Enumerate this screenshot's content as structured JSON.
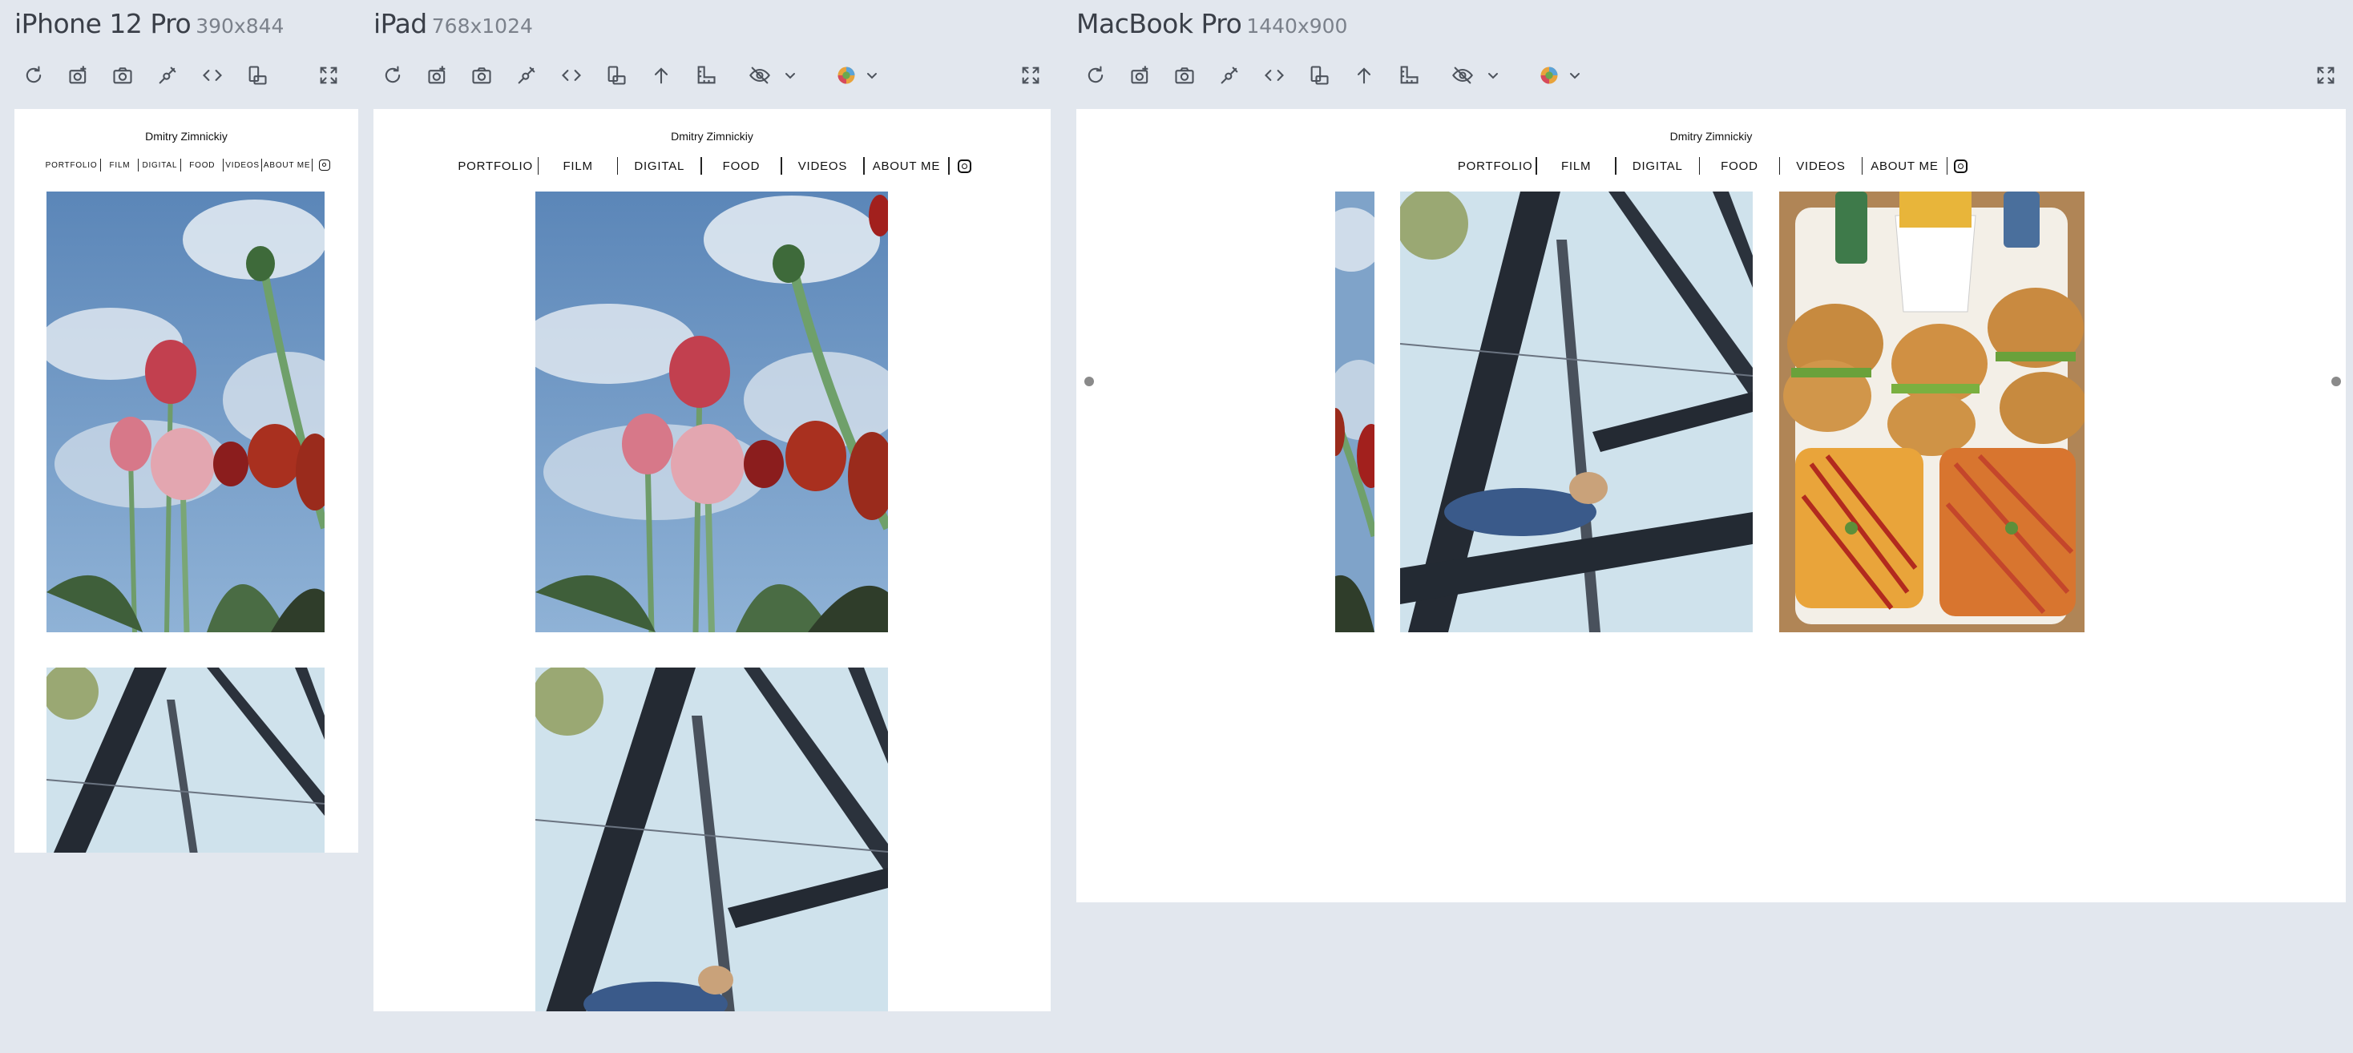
{
  "devices": [
    {
      "name": "iPhone 12 Pro",
      "size": "390x844"
    },
    {
      "name": "iPad",
      "size": "768x1024"
    },
    {
      "name": "MacBook Pro",
      "size": "1440x900"
    }
  ],
  "site": {
    "title": "Dmitry Zimnickiy",
    "nav": [
      "PORTFOLIO",
      "FILM",
      "DIGITAL",
      "FOOD",
      "VIDEOS",
      "ABOUT ME"
    ]
  },
  "toolbar_icons": [
    "refresh-icon",
    "screenshot-icon",
    "camera-icon",
    "link-icon",
    "code-icon",
    "rotate-device-icon",
    "scroll-up-icon",
    "ruler-icon",
    "visibility-icon",
    "color-picker-icon",
    "fullscreen-icon"
  ]
}
